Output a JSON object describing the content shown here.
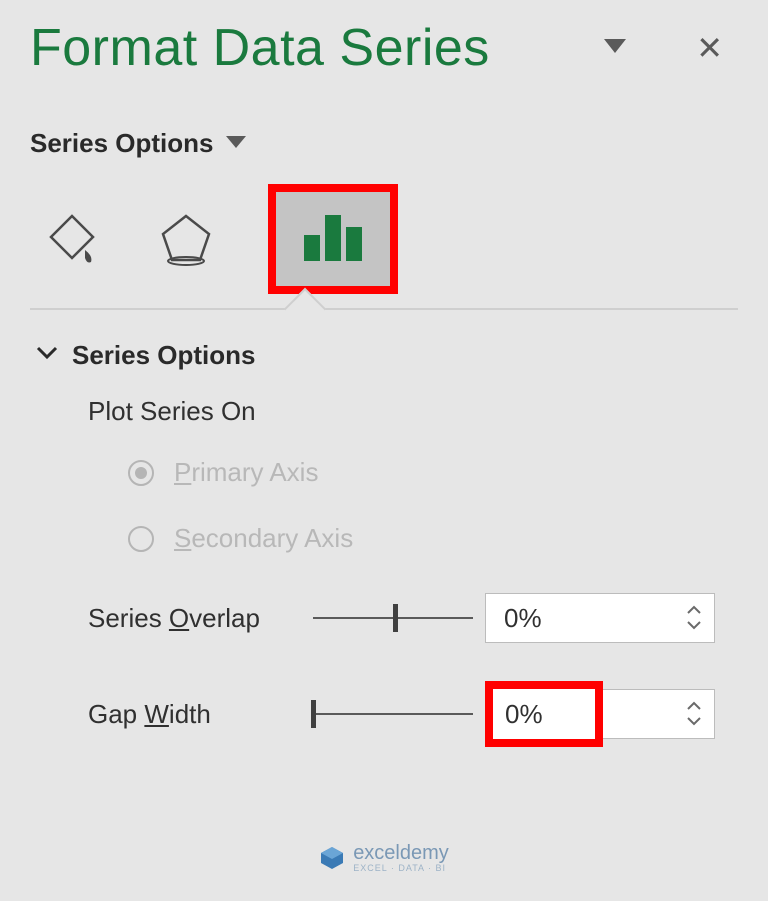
{
  "title": "Format Data Series",
  "dropdown_label": "Series Options",
  "icons": {
    "fill": "paint-bucket-icon",
    "effects": "pentagon-effects-icon",
    "series": "bar-chart-icon"
  },
  "expander": {
    "label": "Series Options"
  },
  "plot_series": {
    "heading": "Plot Series On",
    "primary": "rimary Axis",
    "primary_u": "P",
    "secondary": "econdary Axis",
    "secondary_u": "S"
  },
  "series_overlap": {
    "label_pre": "Series ",
    "label_u": "O",
    "label_post": "verlap",
    "value": "0%"
  },
  "gap_width": {
    "label_pre": "Gap ",
    "label_u": "W",
    "label_post": "idth",
    "value": "0%"
  },
  "watermark": {
    "brand": "exceldemy",
    "tagline": "EXCEL · DATA · BI"
  }
}
